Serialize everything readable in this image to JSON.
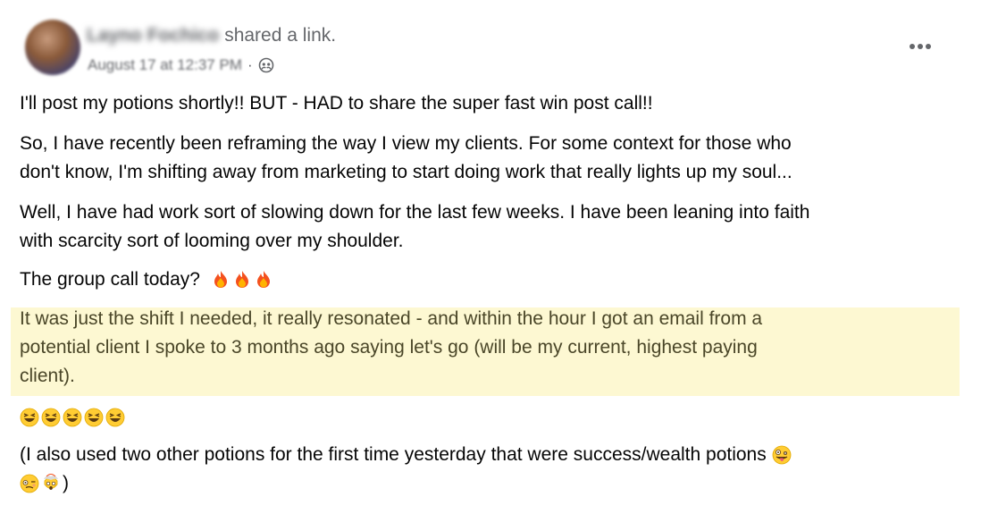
{
  "post": {
    "author_name": "Layno Fochico",
    "action_text": "shared a link.",
    "date": "August 17 at 12:37 PM",
    "separator": "·",
    "audience_icon": "group-icon",
    "more_icon": "more-options-icon"
  },
  "body": {
    "p1": "I'll post my potions shortly!! BUT - HAD to share the super fast win post call!!",
    "p2_line1": "So, I have recently been reframing the way I view my clients. For some context for those who",
    "p2_line2": "don't know, I'm shifting away from marketing to start doing work that really lights up my soul...",
    "p3_line1": "Well, I have had work sort of slowing down for the last few weeks. I have been leaning into faith",
    "p3_line2": "with scarcity sort of looming over my shoulder.",
    "p4": "The group call today?",
    "p4_emojis": [
      "fire-emoji",
      "fire-emoji",
      "fire-emoji"
    ],
    "highlight_line1": "It was just the shift I needed, it really resonated - and within the hour I got an email from a",
    "highlight_line2": "potential client I spoke to 3 months ago saying let's go (will be my current, highest paying",
    "highlight_line3": "client).",
    "laugh_emojis": [
      "laughing-emoji",
      "laughing-emoji",
      "laughing-emoji",
      "laughing-emoji",
      "laughing-emoji"
    ],
    "p6_line1": "(I also used two other potions for the first time yesterday that were success/wealth potions",
    "p6_line2_suffix": ")",
    "p6_emojis": [
      "zany-face-emoji",
      "woozy-face-emoji",
      "exploding-head-emoji"
    ]
  },
  "colors": {
    "highlight_bg": "#fdf8d2",
    "secondary_text": "#65676b",
    "primary_text": "#050505"
  }
}
